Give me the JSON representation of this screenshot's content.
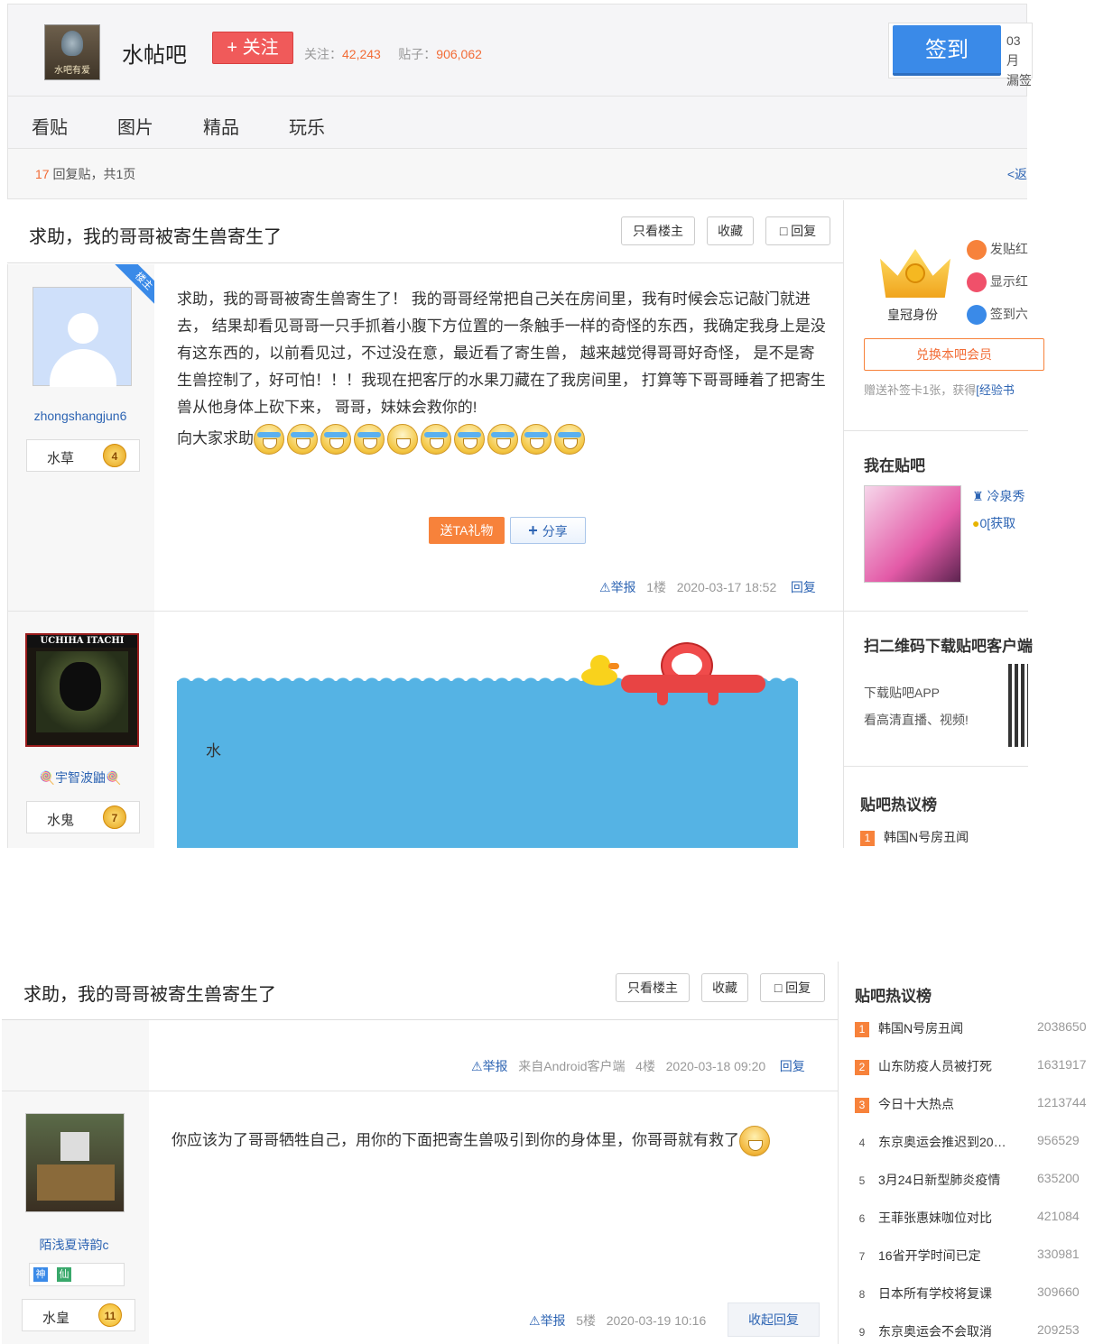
{
  "forum": {
    "name": "水帖吧",
    "logo_text": "水吧有爱",
    "follow_label": "+ 关注",
    "followers_label": "关注：",
    "followers": "42,243",
    "posts_label": "贴子：",
    "posts": "906,062",
    "sign_label": "签到",
    "sign_info_1": "03月",
    "sign_info_2": "漏签"
  },
  "nav": {
    "tabs": [
      "看贴",
      "图片",
      "精品",
      "玩乐"
    ]
  },
  "pager": {
    "count": "17",
    "text_mid": " 回复贴，共",
    "pages": "1",
    "text_end": "页",
    "right": "<返"
  },
  "thread": {
    "title": "求助，我的哥哥被寄生兽寄生了",
    "only_op": "只看楼主",
    "collect": "收藏",
    "reply": "回复"
  },
  "posts": [
    {
      "author": "zhongshangjun6",
      "op_badge": "楼主",
      "level_name": "水草",
      "level": "4",
      "content": "求助，我的哥哥被寄生兽寄生了！ 我的哥哥经常把自己关在房间里，我有时候会忘记敲门就进去， 结果却看见哥哥一只手抓着小腹下方位置的一条触手一样的奇怪的东西，我确定我身上是没有这东西的，以前看见过，不过没在意，最近看了寄生兽， 越来越觉得哥哥好奇怪， 是不是寄生兽控制了，好可怕！！！我现在把客厅的水果刀藏在了我房间里， 打算等下哥哥睡着了把寄生兽从他身体上砍下来， 哥哥，妹妹会救你的!",
      "content2": "向大家求助",
      "gift": "送TA礼物",
      "share": "分享",
      "report": "举报",
      "floor": "1楼",
      "time": "2020-03-17 18:52",
      "reply": "回复"
    },
    {
      "author": "宇智波鼬",
      "avatar_text": "UCHIHA ITACHI",
      "level_name": "水鬼",
      "level": "7",
      "content": "水"
    },
    {
      "report": "举报",
      "source": "来自Android客户端",
      "floor": "4楼",
      "time": "2020-03-18 09:20",
      "reply": "回复"
    },
    {
      "author": "陌浅夏诗韵c",
      "tags": [
        "神",
        "仙"
      ],
      "level_name": "水皇",
      "level": "11",
      "content": "你应该为了哥哥牺牲自己，用你的下面把寄生兽吸引到你的身体里，你哥哥就有救了",
      "report": "举报",
      "floor": "5楼",
      "time": "2020-03-19 10:16",
      "reply": "收起回复"
    }
  ],
  "sidebar": {
    "crown_label": "皇冠身份",
    "perks": [
      "发贴红",
      "显示红",
      "签到六"
    ],
    "exchange": "兑换本吧会员",
    "bonus_text": "赠送补签卡1张，获得",
    "bonus_link": "[经验书",
    "me_title": "我在贴吧",
    "me_name": "冷泉秀",
    "me_coins": "0",
    "me_get": "[获取",
    "qr_title": "扫二维码下载贴吧客户端",
    "qr_line1": "下载贴吧APP",
    "qr_line2": "看高清直播、视频!",
    "hot_title": "贴吧热议榜",
    "hot": [
      {
        "rank": "1",
        "title": "韩国N号房丑闻",
        "count": "2038650"
      },
      {
        "rank": "2",
        "title": "山东防疫人员被打死",
        "count": "1631917"
      },
      {
        "rank": "3",
        "title": "今日十大热点",
        "count": "1213744"
      },
      {
        "rank": "4",
        "title": "东京奥运会推迟到20…",
        "count": "956529"
      },
      {
        "rank": "5",
        "title": "3月24日新型肺炎疫情",
        "count": "635200"
      },
      {
        "rank": "6",
        "title": "王菲张惠妹咖位对比",
        "count": "421084"
      },
      {
        "rank": "7",
        "title": "16省开学时间已定",
        "count": "330981"
      },
      {
        "rank": "8",
        "title": "日本所有学校将复课",
        "count": "309660"
      },
      {
        "rank": "9",
        "title": "东京奥运会不会取消",
        "count": "209253"
      }
    ]
  },
  "colors": {
    "accent": "#2d64b3",
    "follow": "#f05a5a",
    "sign": "#3a8ae8",
    "hot_rank": "#f7823b",
    "water": "#55b3e4"
  }
}
